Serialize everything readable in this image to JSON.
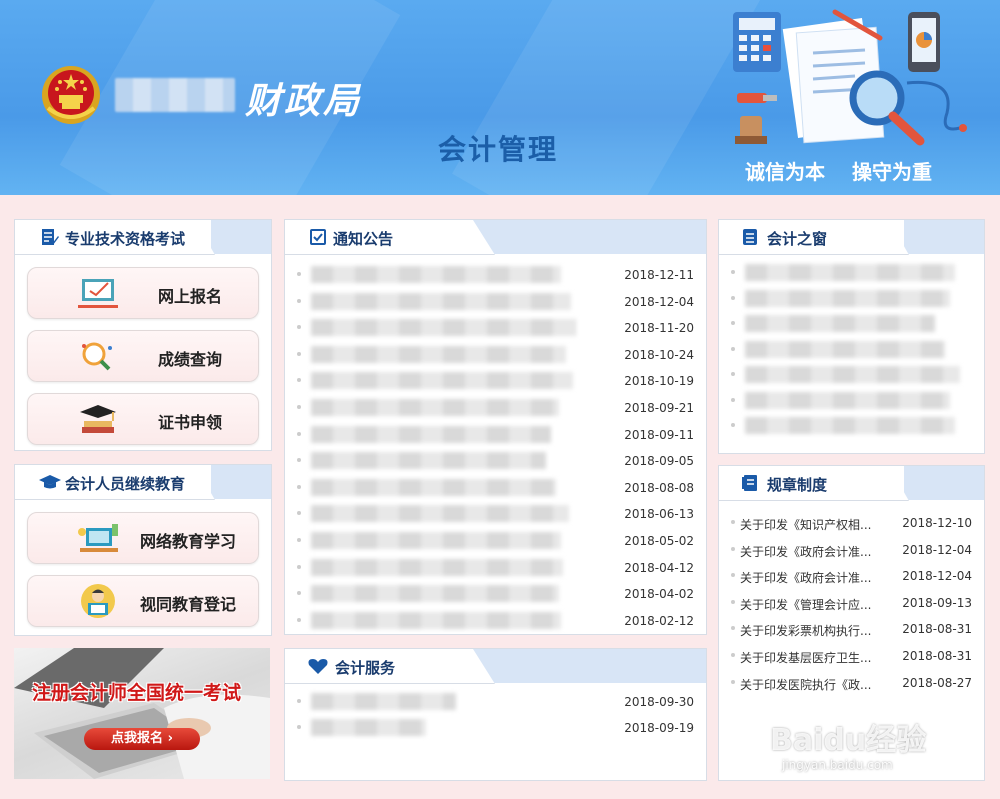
{
  "header": {
    "agency": "财政局",
    "subtitle": "会计管理",
    "motto1": "诚信为本",
    "motto2": "操守为重"
  },
  "exam_panel": {
    "title": "专业技术资格考试",
    "buttons": [
      "网上报名",
      "成绩查询",
      "证书申领"
    ]
  },
  "edu_panel": {
    "title": "会计人员继续教育",
    "buttons": [
      "网络教育学习",
      "视同教育登记"
    ]
  },
  "promo": {
    "text": "注册会计师全国统一考试",
    "cta": "点我报名 ›"
  },
  "notice_panel": {
    "title": "通知公告",
    "dates": [
      "2018-12-11",
      "2018-12-04",
      "2018-11-20",
      "2018-10-24",
      "2018-10-19",
      "2018-09-21",
      "2018-09-11",
      "2018-09-05",
      "2018-08-08",
      "2018-06-13",
      "2018-05-02",
      "2018-04-12",
      "2018-04-02",
      "2018-02-12"
    ]
  },
  "service_panel": {
    "title": "会计服务",
    "dates": [
      "2018-09-30",
      "2018-09-19"
    ]
  },
  "window_panel": {
    "title": "会计之窗"
  },
  "rules_panel": {
    "title": "规章制度",
    "items": [
      {
        "title": "关于印发《知识产权相...",
        "date": "2018-12-10"
      },
      {
        "title": "关于印发《政府会计准...",
        "date": "2018-12-04"
      },
      {
        "title": "关于印发《政府会计准...",
        "date": "2018-12-04"
      },
      {
        "title": "关于印发《管理会计应...",
        "date": "2018-09-13"
      },
      {
        "title": "关于印发彩票机构执行...",
        "date": "2018-08-31"
      },
      {
        "title": "关于印发基层医疗卫生...",
        "date": "2018-08-31"
      },
      {
        "title": "关于印发医院执行《政...",
        "date": "2018-08-27"
      }
    ]
  },
  "watermark": {
    "logo": "Baidu经验",
    "url": "jingyan.baidu.com"
  }
}
